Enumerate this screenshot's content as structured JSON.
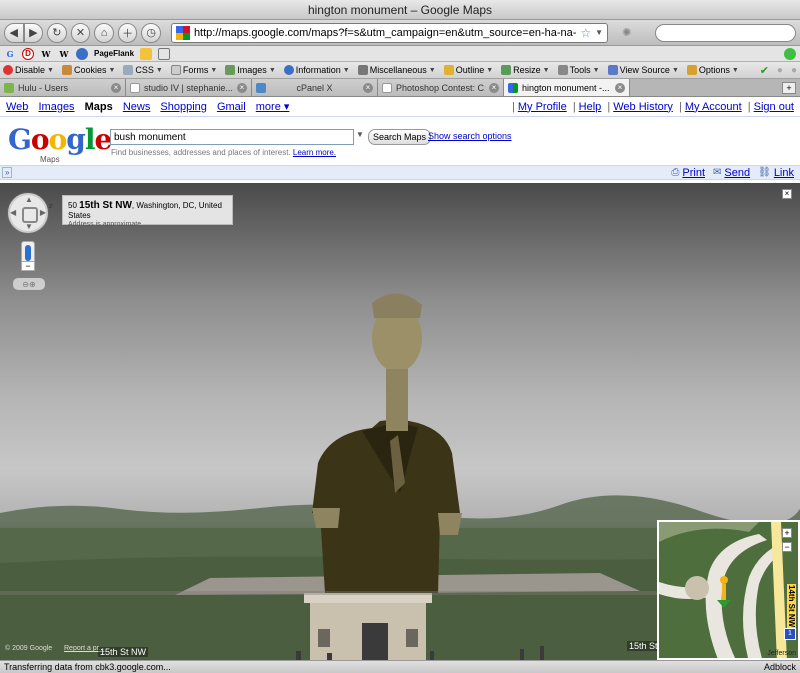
{
  "window": {
    "title": "hington monument – Google Maps"
  },
  "navbar": {
    "url": "http://maps.google.com/maps?f=s&utm_campaign=en&utm_source=en-ha-na-",
    "search_placeholder": ""
  },
  "bookmarks": {
    "pageflank": "PageFlank"
  },
  "webdev": {
    "items": [
      "Disable",
      "Cookies",
      "CSS",
      "Forms",
      "Images",
      "Information",
      "Miscellaneous",
      "Outline",
      "Resize",
      "Tools",
      "View Source",
      "Options"
    ]
  },
  "tabs": [
    {
      "label": "Hulu - Users"
    },
    {
      "label": "studio IV | stephanie..."
    },
    {
      "label": "cPanel X"
    },
    {
      "label": "Photoshop Contest: C..."
    },
    {
      "label": "hington monument -..."
    }
  ],
  "gbar": {
    "links": [
      "Web",
      "Images",
      "Maps",
      "News",
      "Shopping",
      "Gmail",
      "more ▾"
    ],
    "right": [
      "My Profile",
      "Help",
      "Web History",
      "My Account",
      "Sign out"
    ]
  },
  "search": {
    "logo": "Google",
    "logo_sub": "Maps",
    "query": "bush monument",
    "button": "Search Maps",
    "options_link": "Show search options",
    "hint": "Find businesses, addresses and places of interest.",
    "hint_link": "Learn more."
  },
  "actions": {
    "print": "Print",
    "send": "Send",
    "link": "Link",
    "expand": "»"
  },
  "streetview": {
    "address_num": "50",
    "address_street": "15th St NW",
    "address_city": ", Washington, DC, United States",
    "address_note": "Address is approximate",
    "copyright": "© 2009 Google",
    "report": "Report a pr...",
    "street_label_left": "15th St NW",
    "street_label_right": "15th St",
    "minimap_road": "14th St NW",
    "minimap_route": "1",
    "minimap_label": "Jefferson"
  },
  "status": {
    "text": "Transferring data from cbk3.google.com...",
    "addon": "Adblock"
  },
  "colors": {
    "google_blue": "#3366cc",
    "link": "#0000cc",
    "accent_bar": "#e5ecf9"
  }
}
